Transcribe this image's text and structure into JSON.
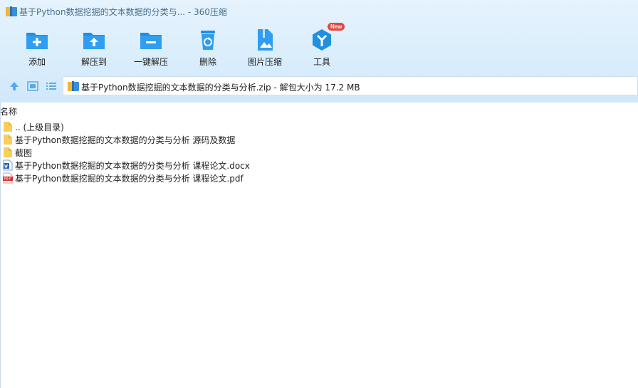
{
  "window": {
    "title": "基于Python数据挖掘的文本数据的分类与... - 360压缩"
  },
  "toolbar": {
    "buttons": [
      {
        "label": "添加",
        "icon": "add-folder-icon"
      },
      {
        "label": "解压到",
        "icon": "extract-to-icon"
      },
      {
        "label": "一键解压",
        "icon": "one-click-extract-icon"
      },
      {
        "label": "删除",
        "icon": "recycle-bin-icon"
      },
      {
        "label": "图片压缩",
        "icon": "image-compress-icon"
      },
      {
        "label": "工具",
        "icon": "tools-icon",
        "badge": "New"
      }
    ]
  },
  "nav": {
    "path": "基于Python数据挖掘的文本数据的分类与分析.zip - 解包大小为 17.2 MB"
  },
  "list": {
    "header": "名称",
    "items": [
      {
        "name": ".. (上级目录)",
        "type": "folder"
      },
      {
        "name": "基于Python数据挖掘的文本数据的分类与分析 源码及数据",
        "type": "folder"
      },
      {
        "name": "截图",
        "type": "folder"
      },
      {
        "name": "基于Python数据挖掘的文本数据的分类与分析 课程论文.docx",
        "type": "docx"
      },
      {
        "name": "基于Python数据挖掘的文本数据的分类与分析 课程论文.pdf",
        "type": "pdf"
      }
    ]
  },
  "colors": {
    "accent": "#1e8fe1",
    "chrome": "#d9edfc",
    "badge": "#e8433a"
  }
}
